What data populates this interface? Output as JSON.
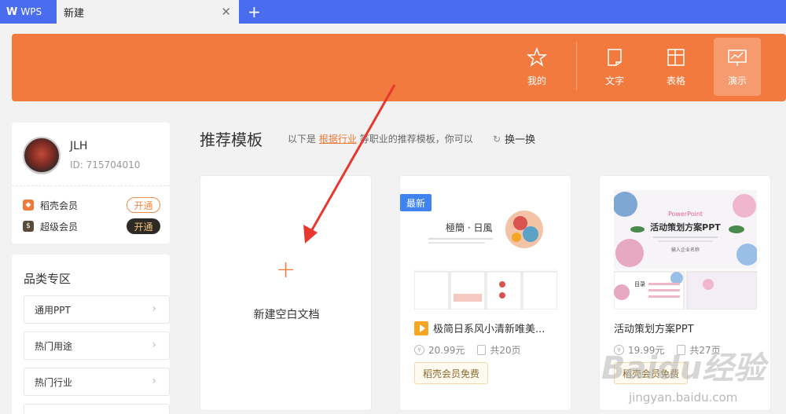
{
  "tabs": {
    "app_tab": "WPS",
    "doc_tab": "新建"
  },
  "nav": [
    {
      "label": "我的",
      "icon": "star-icon"
    },
    {
      "label": "文字",
      "icon": "document-icon"
    },
    {
      "label": "表格",
      "icon": "table-icon"
    },
    {
      "label": "演示",
      "icon": "presentation-icon",
      "active": true
    }
  ],
  "user": {
    "name": "JLH",
    "id": "ID: 715704010",
    "memberships": [
      {
        "label": "稻壳会员",
        "action": "开通"
      },
      {
        "label": "超级会员",
        "action": "开通"
      }
    ]
  },
  "categories": {
    "title": "品类专区",
    "items": [
      "通用PPT",
      "热门用途",
      "热门行业"
    ]
  },
  "main": {
    "title": "推荐模板",
    "subtitle_before": "以下是",
    "subtitle_link": "根据行业",
    "subtitle_after": "等职业的推荐模板，你可以",
    "swap_label": "换一换"
  },
  "new_doc": {
    "label": "新建空白文档"
  },
  "templates": [
    {
      "badge": "最新",
      "thumb_title": "極簡 · 日風",
      "title": "极简日系风小清新唯美...",
      "price": "20.99元",
      "pages": "共20页",
      "free_label": "稻壳会员免费"
    },
    {
      "thumb_brand": "PowerPoint",
      "thumb_title": "活动策划方案PPT",
      "thumb_sub": "输入企业名称",
      "thumb_toc": "目录",
      "title": "活动策划方案PPT",
      "price": "19.99元",
      "pages": "共27页",
      "free_label": "稻壳会员免费"
    }
  ],
  "watermark": {
    "brand": "Baidu经验",
    "url": "jingyan.baidu.com"
  },
  "colors": {
    "titlebar": "#4a6df0",
    "banner": "#f27a3f",
    "accent": "#f07a3c",
    "badge_blue": "#3f83f0"
  }
}
